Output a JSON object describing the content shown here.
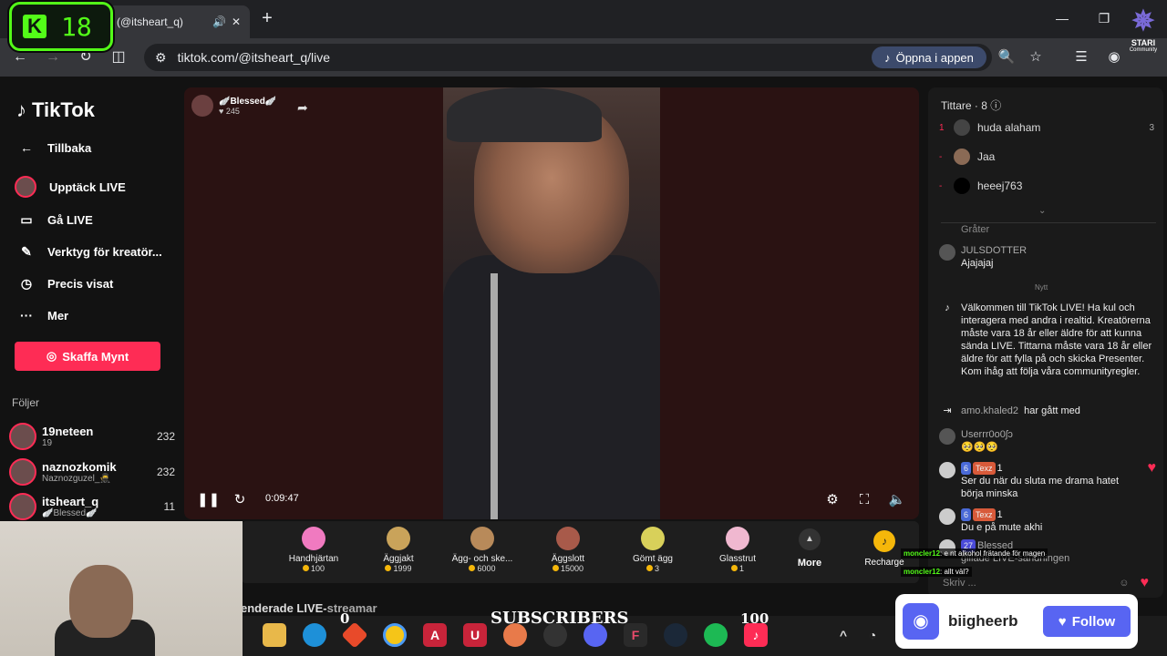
{
  "browser": {
    "tab_title": "(@itsheart_q)",
    "url": "tiktok.com/@itsheart_q/live",
    "open_app": "Öppna i appen"
  },
  "kick_overlay": {
    "letter": "K",
    "count": "18"
  },
  "stari": {
    "name": "STARI",
    "sub": "Community"
  },
  "sidebar": {
    "logo": "TikTok",
    "nav": [
      {
        "label": "Tillbaka",
        "icon": "arrow-left-icon"
      },
      {
        "label": "Upptäck LIVE",
        "icon": "live-avatar-icon"
      },
      {
        "label": "Gå LIVE",
        "icon": "camera-icon"
      },
      {
        "label": "Verktyg för kreatör...",
        "icon": "tools-icon"
      },
      {
        "label": "Precis visat",
        "icon": "history-icon"
      },
      {
        "label": "Mer",
        "icon": "more-icon"
      }
    ],
    "coins_button": "Skaffa Mynt",
    "following_header": "Följer",
    "following": [
      {
        "name": "19neteen",
        "sub": "19",
        "count": "232"
      },
      {
        "name": "naznozkomik",
        "sub": "Naznozguzel_🥷",
        "count": "232"
      },
      {
        "name": "itsheart_q",
        "sub": "🪽Blessed🪽",
        "count": "11"
      }
    ]
  },
  "stream": {
    "title": "🪽Blessed🪽",
    "likes": "245",
    "time": "0:09:47"
  },
  "gifts": [
    {
      "name": "Handhjärtan",
      "price": "100",
      "color": "#f07ac0"
    },
    {
      "name": "Äggjakt",
      "price": "1999",
      "color": "#c9a35a"
    },
    {
      "name": "Ägg- och ske...",
      "price": "6000",
      "color": "#b88a5a"
    },
    {
      "name": "Äggslott",
      "price": "15000",
      "color": "#a85a4a"
    },
    {
      "name": "Gömt ägg",
      "price": "3",
      "color": "#d8d05a"
    },
    {
      "name": "Glasstrut",
      "price": "1",
      "color": "#f0b8d0"
    }
  ],
  "more_label": "More",
  "recharge_label": "Recharge",
  "recommended": {
    "prefix": "enderade LIVE-",
    "suffix": "streamar"
  },
  "chat": {
    "viewers_label": "Tittare · 8",
    "viewers": [
      {
        "rank": "1",
        "name": "huda alaham",
        "count": "3"
      },
      {
        "rank": "-",
        "name": "Jaa",
        "count": ""
      },
      {
        "rank": "-",
        "name": "heeej763",
        "count": ""
      }
    ],
    "graeter": "Gråter",
    "messages": [
      {
        "user": "JULSDOTTER",
        "text": "Ajajajaj"
      },
      {
        "user": "",
        "text": "Välkommen till TikTok LIVE! Ha kul och interagera med andra i realtid. Kreatörerna måste vara 18 år eller äldre för att kunna sända LIVE. Tittarna måste vara 18 år eller äldre för att fylla på och skicka Presenter. Kom ihåg att följa våra communityregler."
      },
      {
        "user": "amo.khaled2",
        "text": "har gått med"
      },
      {
        "user": "Userrr0o0ʃɔ",
        "text": "🥺🥺🥺"
      },
      {
        "user": "Texz",
        "badge1": "6",
        "badge2": "1",
        "text": "Ser du när du sluta me drama hatet börja minska"
      },
      {
        "user": "Texz",
        "badge1": "6",
        "badge2": "1",
        "text": "Du e på mute akhi"
      },
      {
        "user": "Blessed",
        "badge1": "27",
        "text": "gillade LIVE-sändningen"
      }
    ],
    "nytt": "Nytt",
    "input_placeholder": "Skriv ..."
  },
  "overlay": {
    "sub_zero": "0",
    "sub_label": "SUBSCRIBERS",
    "sub_target": "100",
    "twitch_lines": [
      {
        "user": "moncler12",
        "text": "e nt alkohol frätande för magen"
      },
      {
        "user": "moncler12",
        "text": "allt väl?"
      }
    ],
    "discord_name": "biigheerb",
    "discord_follow": "Follow"
  }
}
